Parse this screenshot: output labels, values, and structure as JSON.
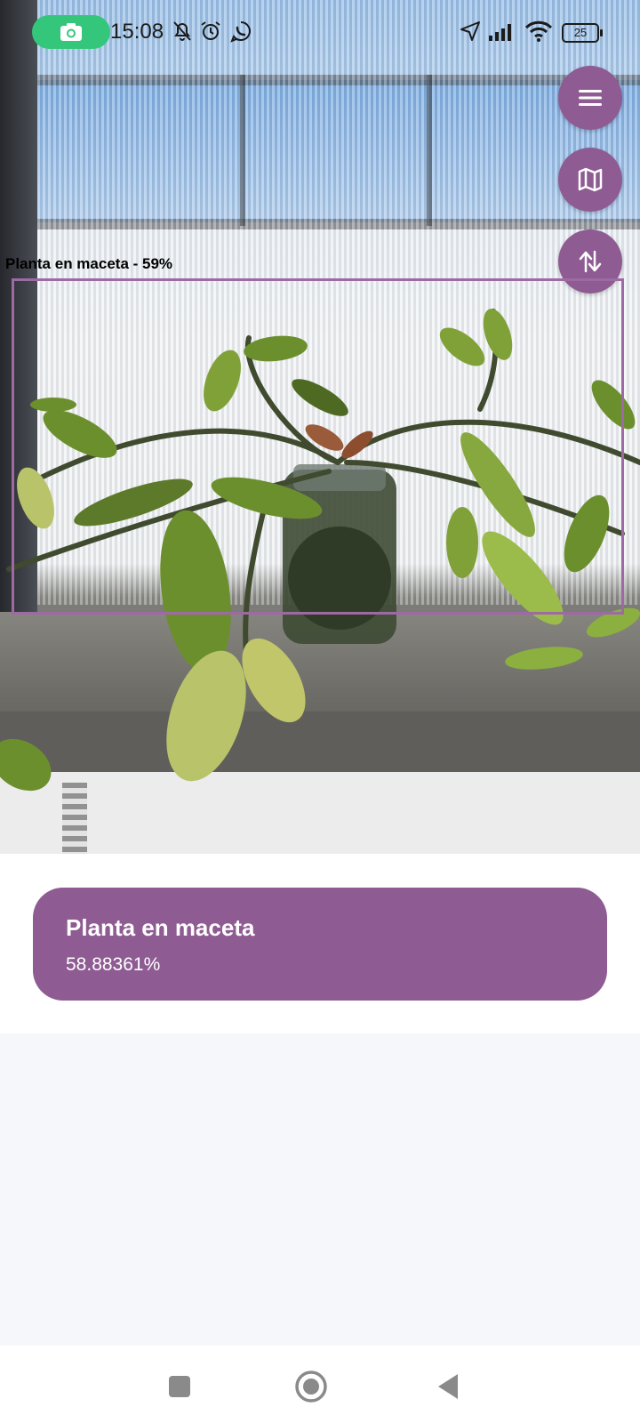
{
  "status_bar": {
    "time": "15:08",
    "battery": "25"
  },
  "detection": {
    "overlay_label": "Planta en maceta - 59%",
    "box_color": "#9d6aa4",
    "confidence_fraction": 0.5888361
  },
  "result": {
    "label": "Planta en maceta",
    "confidence": "58.88361%"
  },
  "fabs": [
    {
      "icon": "menu-icon"
    },
    {
      "icon": "map-icon"
    },
    {
      "icon": "swap-vertical-icon"
    }
  ],
  "nav": [
    "recents-square-icon",
    "home-circle-icon",
    "back-triangle-icon"
  ],
  "colors": {
    "accent": "#8e5b92",
    "record_pill": "#34c77b",
    "background": "#f6f7fb"
  }
}
